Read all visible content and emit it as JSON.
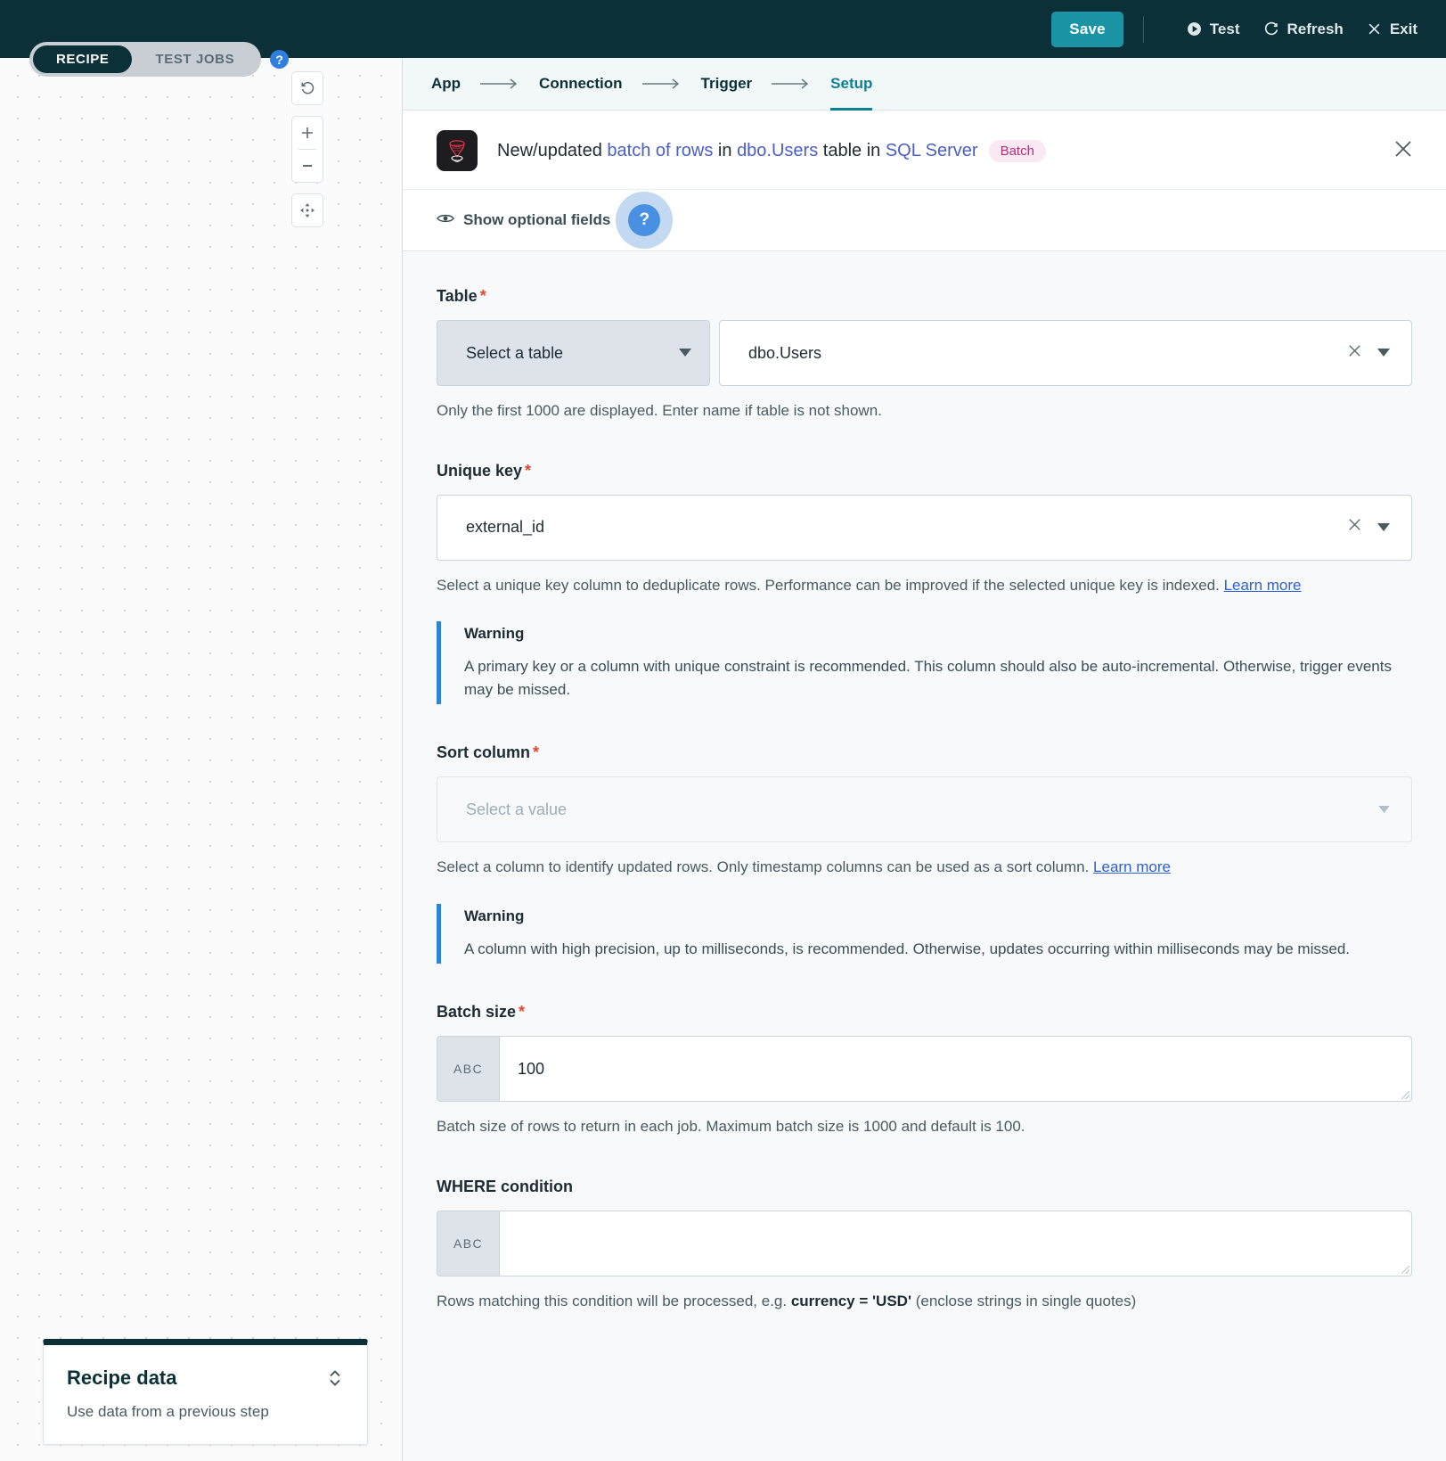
{
  "topbar": {
    "save_label": "Save",
    "actions": [
      {
        "label": "Test",
        "icon": "play-circle-icon"
      },
      {
        "label": "Refresh",
        "icon": "refresh-icon"
      },
      {
        "label": "Exit",
        "icon": "close-icon"
      }
    ]
  },
  "canvas": {
    "tabs": [
      {
        "label": "RECIPE",
        "active": true
      },
      {
        "label": "TEST JOBS",
        "active": false
      }
    ],
    "help_label": "?",
    "controls": [
      {
        "name": "reset-icon"
      },
      {
        "name": "zoom-in-icon"
      },
      {
        "name": "zoom-out-icon"
      },
      {
        "name": "fit-screen-icon"
      }
    ],
    "recipe_data": {
      "title": "Recipe data",
      "subtitle": "Use data from a previous step"
    }
  },
  "steps": [
    {
      "label": "App",
      "active": false
    },
    {
      "label": "Connection",
      "active": false
    },
    {
      "label": "Trigger",
      "active": false
    },
    {
      "label": "Setup",
      "active": true
    }
  ],
  "header": {
    "icon": "sql-server-icon",
    "title_prefix": "New/updated ",
    "title_link1": "batch of rows",
    "title_mid1": " in ",
    "title_link2": "dbo.Users",
    "title_mid2": " table in ",
    "title_link3": "SQL Server",
    "badge": "Batch",
    "show_optional_label": "Show optional fields",
    "help_glyph": "?",
    "close_glyph": "✕"
  },
  "fields": {
    "table": {
      "label": "Table",
      "required": "*",
      "select_value": "Select a table",
      "input_value": "dbo.Users",
      "help": "Only the first 1000 are displayed. Enter name if table is not shown."
    },
    "unique_key": {
      "label": "Unique key",
      "required": "*",
      "value": "external_id",
      "help_pre": "Select a unique key column to deduplicate rows. Performance can be improved if the selected unique key is indexed. ",
      "help_link": "Learn more",
      "warning_title": "Warning",
      "warning_body": "A primary key or a column with unique constraint is recommended. This column should also be auto-incremental. Otherwise, trigger events may be missed."
    },
    "sort_column": {
      "label": "Sort column",
      "required": "*",
      "placeholder": "Select a value",
      "help_pre": "Select a column to identify updated rows. Only timestamp columns can be used as a sort column. ",
      "help_link": "Learn more",
      "warning_title": "Warning",
      "warning_body": "A column with high precision, up to milliseconds, is recommended. Otherwise, updates occurring within milliseconds may be missed."
    },
    "batch_size": {
      "label": "Batch size",
      "required": "*",
      "tag": "ABC",
      "value": "100",
      "help": "Batch size of rows to return in each job. Maximum batch size is 1000 and default is 100."
    },
    "where_condition": {
      "label": "WHERE condition",
      "tag": "ABC",
      "value": "",
      "help_pre": "Rows matching this condition will be processed, e.g. ",
      "help_bold": "currency = 'USD'",
      "help_post": " (enclose strings in single quotes)"
    }
  },
  "colors": {
    "topbar_bg": "#0b3038",
    "accent_teal": "#1a94a5",
    "active_step": "#0f7f93",
    "badge_bg": "#fae9f1",
    "badge_fg": "#a8327a",
    "link": "#4a5ec8",
    "warning_bar": "#2f84d6",
    "required": "#e2452c",
    "help_blue": "#4a90e2"
  }
}
